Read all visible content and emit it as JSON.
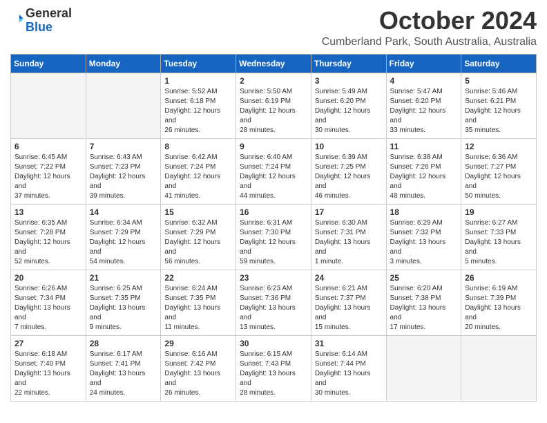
{
  "logo": {
    "general": "General",
    "blue": "Blue"
  },
  "title": "October 2024",
  "location": "Cumberland Park, South Australia, Australia",
  "days_of_week": [
    "Sunday",
    "Monday",
    "Tuesday",
    "Wednesday",
    "Thursday",
    "Friday",
    "Saturday"
  ],
  "weeks": [
    [
      {
        "day": "",
        "sunrise": "",
        "sunset": "",
        "daylight": ""
      },
      {
        "day": "",
        "sunrise": "",
        "sunset": "",
        "daylight": ""
      },
      {
        "day": "1",
        "sunrise": "Sunrise: 5:52 AM",
        "sunset": "Sunset: 6:18 PM",
        "daylight": "Daylight: 12 hours and 26 minutes."
      },
      {
        "day": "2",
        "sunrise": "Sunrise: 5:50 AM",
        "sunset": "Sunset: 6:19 PM",
        "daylight": "Daylight: 12 hours and 28 minutes."
      },
      {
        "day": "3",
        "sunrise": "Sunrise: 5:49 AM",
        "sunset": "Sunset: 6:20 PM",
        "daylight": "Daylight: 12 hours and 30 minutes."
      },
      {
        "day": "4",
        "sunrise": "Sunrise: 5:47 AM",
        "sunset": "Sunset: 6:20 PM",
        "daylight": "Daylight: 12 hours and 33 minutes."
      },
      {
        "day": "5",
        "sunrise": "Sunrise: 5:46 AM",
        "sunset": "Sunset: 6:21 PM",
        "daylight": "Daylight: 12 hours and 35 minutes."
      }
    ],
    [
      {
        "day": "6",
        "sunrise": "Sunrise: 6:45 AM",
        "sunset": "Sunset: 7:22 PM",
        "daylight": "Daylight: 12 hours and 37 minutes."
      },
      {
        "day": "7",
        "sunrise": "Sunrise: 6:43 AM",
        "sunset": "Sunset: 7:23 PM",
        "daylight": "Daylight: 12 hours and 39 minutes."
      },
      {
        "day": "8",
        "sunrise": "Sunrise: 6:42 AM",
        "sunset": "Sunset: 7:24 PM",
        "daylight": "Daylight: 12 hours and 41 minutes."
      },
      {
        "day": "9",
        "sunrise": "Sunrise: 6:40 AM",
        "sunset": "Sunset: 7:24 PM",
        "daylight": "Daylight: 12 hours and 44 minutes."
      },
      {
        "day": "10",
        "sunrise": "Sunrise: 6:39 AM",
        "sunset": "Sunset: 7:25 PM",
        "daylight": "Daylight: 12 hours and 46 minutes."
      },
      {
        "day": "11",
        "sunrise": "Sunrise: 6:38 AM",
        "sunset": "Sunset: 7:26 PM",
        "daylight": "Daylight: 12 hours and 48 minutes."
      },
      {
        "day": "12",
        "sunrise": "Sunrise: 6:36 AM",
        "sunset": "Sunset: 7:27 PM",
        "daylight": "Daylight: 12 hours and 50 minutes."
      }
    ],
    [
      {
        "day": "13",
        "sunrise": "Sunrise: 6:35 AM",
        "sunset": "Sunset: 7:28 PM",
        "daylight": "Daylight: 12 hours and 52 minutes."
      },
      {
        "day": "14",
        "sunrise": "Sunrise: 6:34 AM",
        "sunset": "Sunset: 7:29 PM",
        "daylight": "Daylight: 12 hours and 54 minutes."
      },
      {
        "day": "15",
        "sunrise": "Sunrise: 6:32 AM",
        "sunset": "Sunset: 7:29 PM",
        "daylight": "Daylight: 12 hours and 56 minutes."
      },
      {
        "day": "16",
        "sunrise": "Sunrise: 6:31 AM",
        "sunset": "Sunset: 7:30 PM",
        "daylight": "Daylight: 12 hours and 59 minutes."
      },
      {
        "day": "17",
        "sunrise": "Sunrise: 6:30 AM",
        "sunset": "Sunset: 7:31 PM",
        "daylight": "Daylight: 13 hours and 1 minute."
      },
      {
        "day": "18",
        "sunrise": "Sunrise: 6:29 AM",
        "sunset": "Sunset: 7:32 PM",
        "daylight": "Daylight: 13 hours and 3 minutes."
      },
      {
        "day": "19",
        "sunrise": "Sunrise: 6:27 AM",
        "sunset": "Sunset: 7:33 PM",
        "daylight": "Daylight: 13 hours and 5 minutes."
      }
    ],
    [
      {
        "day": "20",
        "sunrise": "Sunrise: 6:26 AM",
        "sunset": "Sunset: 7:34 PM",
        "daylight": "Daylight: 13 hours and 7 minutes."
      },
      {
        "day": "21",
        "sunrise": "Sunrise: 6:25 AM",
        "sunset": "Sunset: 7:35 PM",
        "daylight": "Daylight: 13 hours and 9 minutes."
      },
      {
        "day": "22",
        "sunrise": "Sunrise: 6:24 AM",
        "sunset": "Sunset: 7:35 PM",
        "daylight": "Daylight: 13 hours and 11 minutes."
      },
      {
        "day": "23",
        "sunrise": "Sunrise: 6:23 AM",
        "sunset": "Sunset: 7:36 PM",
        "daylight": "Daylight: 13 hours and 13 minutes."
      },
      {
        "day": "24",
        "sunrise": "Sunrise: 6:21 AM",
        "sunset": "Sunset: 7:37 PM",
        "daylight": "Daylight: 13 hours and 15 minutes."
      },
      {
        "day": "25",
        "sunrise": "Sunrise: 6:20 AM",
        "sunset": "Sunset: 7:38 PM",
        "daylight": "Daylight: 13 hours and 17 minutes."
      },
      {
        "day": "26",
        "sunrise": "Sunrise: 6:19 AM",
        "sunset": "Sunset: 7:39 PM",
        "daylight": "Daylight: 13 hours and 20 minutes."
      }
    ],
    [
      {
        "day": "27",
        "sunrise": "Sunrise: 6:18 AM",
        "sunset": "Sunset: 7:40 PM",
        "daylight": "Daylight: 13 hours and 22 minutes."
      },
      {
        "day": "28",
        "sunrise": "Sunrise: 6:17 AM",
        "sunset": "Sunset: 7:41 PM",
        "daylight": "Daylight: 13 hours and 24 minutes."
      },
      {
        "day": "29",
        "sunrise": "Sunrise: 6:16 AM",
        "sunset": "Sunset: 7:42 PM",
        "daylight": "Daylight: 13 hours and 26 minutes."
      },
      {
        "day": "30",
        "sunrise": "Sunrise: 6:15 AM",
        "sunset": "Sunset: 7:43 PM",
        "daylight": "Daylight: 13 hours and 28 minutes."
      },
      {
        "day": "31",
        "sunrise": "Sunrise: 6:14 AM",
        "sunset": "Sunset: 7:44 PM",
        "daylight": "Daylight: 13 hours and 30 minutes."
      },
      {
        "day": "",
        "sunrise": "",
        "sunset": "",
        "daylight": ""
      },
      {
        "day": "",
        "sunrise": "",
        "sunset": "",
        "daylight": ""
      }
    ]
  ]
}
